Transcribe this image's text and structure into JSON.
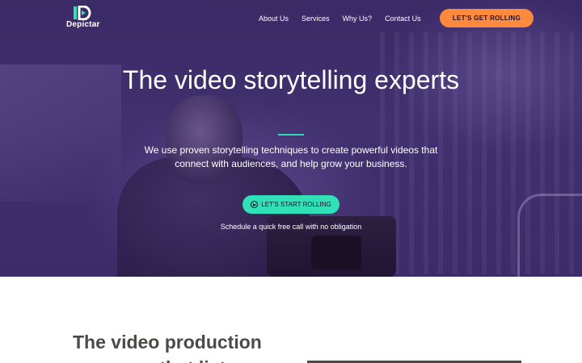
{
  "brand": {
    "name": "Depictar",
    "accent": "#30e0b6",
    "cta_color": "#ff8a3d",
    "hero_overlay": "#3a2a66"
  },
  "nav": {
    "links": [
      "About Us",
      "Services",
      "Why Us?",
      "Contact Us"
    ],
    "cta_label": "LET'S GET ROLLING"
  },
  "hero": {
    "title": "The video storytelling experts",
    "subtitle": "We use proven storytelling techniques to create powerful videos that connect with audiences, and help grow your business.",
    "cta_label": "LET'S START ROLLING",
    "cta_icon": "play-circle-icon",
    "note": "Schedule a quick free call with no obligation"
  },
  "section": {
    "title": "The video production company that lists"
  }
}
